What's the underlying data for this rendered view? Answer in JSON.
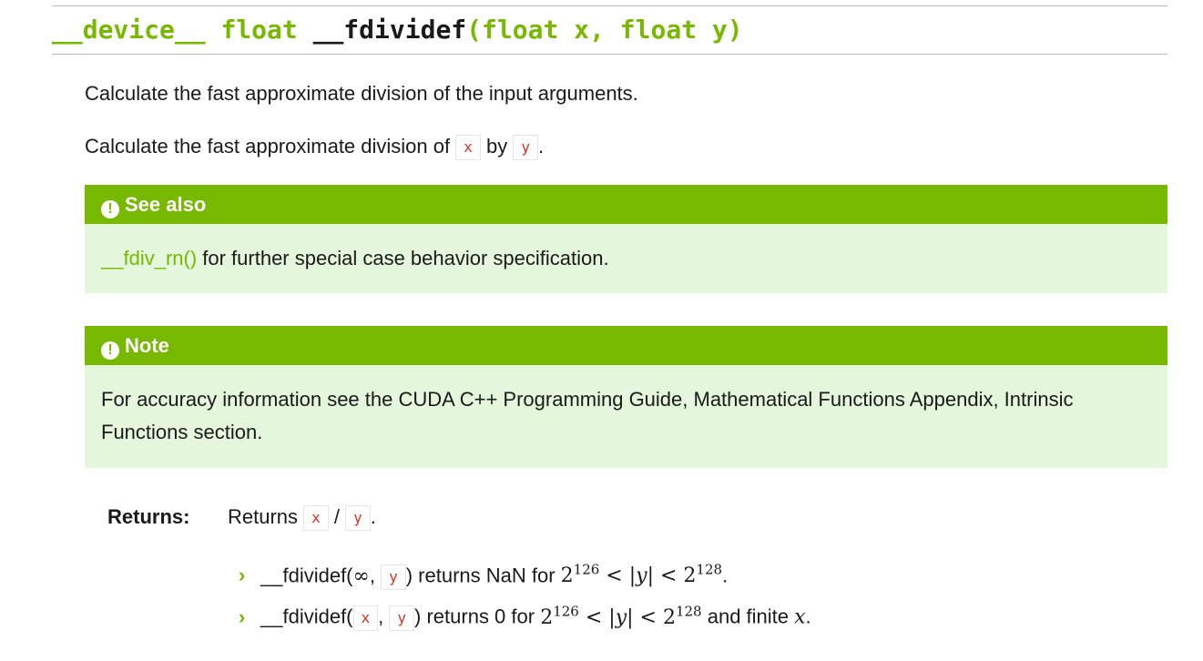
{
  "signature": {
    "qualifier": "__device__",
    "return_type": "float",
    "function_name": "__fdividef",
    "open_paren": "(",
    "param1": "float x",
    "comma": ", ",
    "param2": "float y",
    "close_paren": ")"
  },
  "description": {
    "summary": "Calculate the fast approximate division of the input arguments.",
    "detail_prefix": "Calculate the fast approximate division of ",
    "detail_arg1": "x",
    "detail_mid": " by ",
    "detail_arg2": "y",
    "detail_suffix": "."
  },
  "see_also": {
    "title": "See also",
    "link_text": "__fdiv_rn()",
    "text": " for further special case behavior specification."
  },
  "note": {
    "title": "Note",
    "text": "For accuracy information see the CUDA C++ Programming Guide, Mathematical Functions Appendix, Intrinsic Functions section."
  },
  "returns": {
    "label": "Returns:",
    "prefix": "Returns ",
    "arg1": "x",
    "op": " / ",
    "arg2": "y",
    "suffix": ".",
    "items": [
      {
        "fn": "__fdividef(",
        "a1": "∞",
        "sep": ", ",
        "a2": "y",
        "close": ")",
        "text": " returns NaN for ",
        "base1": "2",
        "exp1": "126",
        "rel1": " < |",
        "var": "y",
        "rel2": "| < ",
        "base2": "2",
        "exp2": "128",
        "tail": ".",
        "tail_var": ""
      },
      {
        "fn": "__fdividef(",
        "a1": "x",
        "sep": ", ",
        "a2": "y",
        "close": ")",
        "text": " returns 0 for ",
        "base1": "2",
        "exp1": "126",
        "rel1": " < |",
        "var": "y",
        "rel2": "| < ",
        "base2": "2",
        "exp2": "128",
        "tail": " and finite ",
        "tail_var": "x",
        "end": "."
      }
    ]
  },
  "colors": {
    "accent": "#76b900",
    "admonition_bg": "#e4f7dd",
    "code": "#e02e24"
  }
}
